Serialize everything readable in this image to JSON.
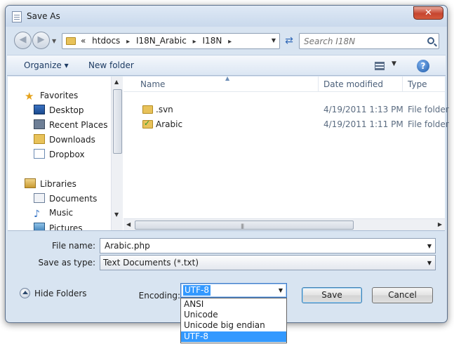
{
  "window": {
    "title": "Save As",
    "close_glyph": "✕"
  },
  "address": {
    "crumbs": [
      "«",
      "htdocs",
      "I18N_Arabic",
      "I18N"
    ],
    "separator": "▸"
  },
  "search": {
    "placeholder": "Search I18N"
  },
  "toolbar": {
    "organize": "Organize ▾",
    "new_folder": "New folder",
    "views_drop": "▼",
    "help": "?"
  },
  "nav": {
    "favorites_label": "Favorites",
    "favorites": [
      "Desktop",
      "Recent Places",
      "Downloads",
      "Dropbox"
    ],
    "libraries_label": "Libraries",
    "libraries": [
      "Documents",
      "Music",
      "Pictures"
    ]
  },
  "columns": {
    "name": "Name",
    "date": "Date modified",
    "type": "Type"
  },
  "files": [
    {
      "name": ".svn",
      "date": "4/19/2011 1:13 PM",
      "type": "File folder"
    },
    {
      "name": "Arabic",
      "date": "4/19/2011 1:11 PM",
      "type": "File folder"
    }
  ],
  "form": {
    "file_name_label": "File name:",
    "file_name_value": "Arabic.php",
    "save_as_type_label": "Save as type:",
    "save_as_type_value": "Text Documents (*.txt)",
    "encoding_label": "Encoding:",
    "encoding_value": "UTF-8",
    "encoding_options": [
      "ANSI",
      "Unicode",
      "Unicode big endian",
      "UTF-8"
    ],
    "encoding_selected_index": 3
  },
  "buttons": {
    "hide_folders": "Hide Folders",
    "save": "Save",
    "cancel": "Cancel"
  },
  "colors": {
    "accent": "#3399ff",
    "close": "#c6452f",
    "window_frame": "#d8e4f1"
  }
}
